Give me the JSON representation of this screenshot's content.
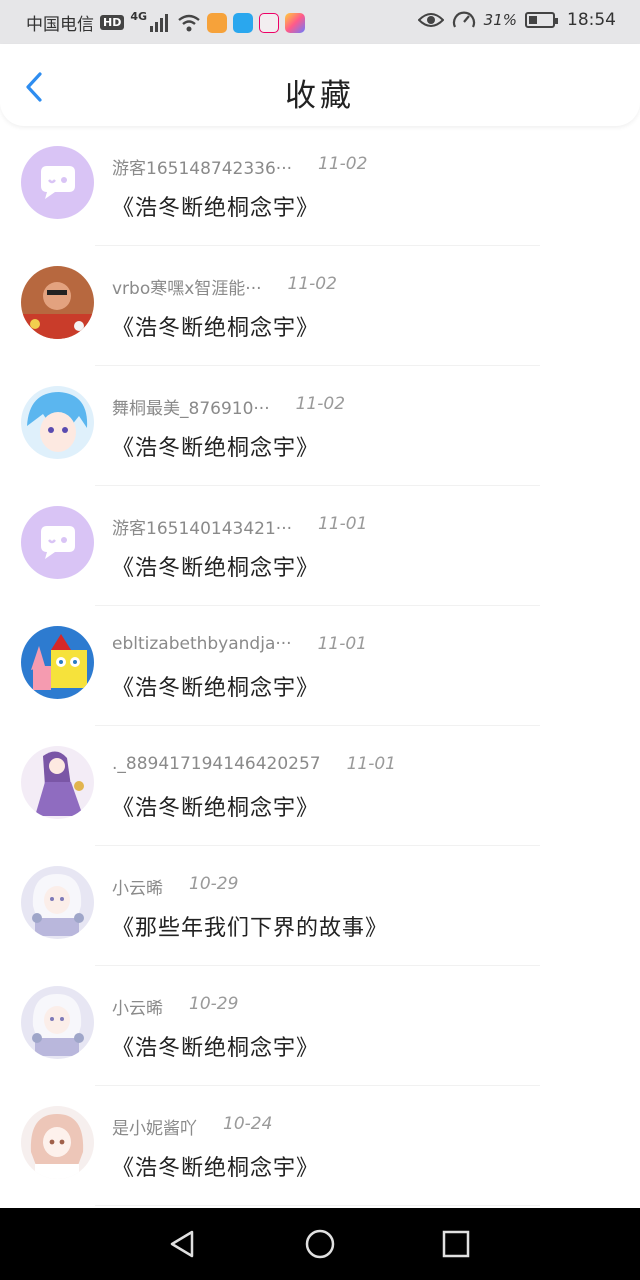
{
  "status_bar": {
    "carrier": "中国电信",
    "hd": "HD",
    "network": "4G",
    "battery_percent": "31%",
    "battery_level": 0.31,
    "time": "18:54"
  },
  "header": {
    "title": "收藏",
    "back_icon": "chevron-left-icon"
  },
  "colors": {
    "accent": "#2e8df0",
    "guest_avatar": "#d9c4f5"
  },
  "favorites": [
    {
      "user": "游客165148742336···",
      "time": "11-02",
      "content": "《浩冬断绝桐念宇》",
      "avatar": "guest-chat-bubble"
    },
    {
      "user": "vrbo寒嘿x智涯能···",
      "time": "11-02",
      "content": "《浩冬断绝桐念宇》",
      "avatar": "user-photo"
    },
    {
      "user": "舞桐最美_876910···",
      "time": "11-02",
      "content": "《浩冬断绝桐念宇》",
      "avatar": "anime-blue-hair"
    },
    {
      "user": "游客165140143421···",
      "time": "11-01",
      "content": "《浩冬断绝桐念宇》",
      "avatar": "guest-chat-bubble"
    },
    {
      "user": "ebltizabethbyandja···",
      "time": "11-01",
      "content": "《浩冬断绝桐念宇》",
      "avatar": "spongebob-patrick"
    },
    {
      "user": "._889417194146420257",
      "time": "11-01",
      "content": "《浩冬断绝桐念宇》",
      "avatar": "anime-purple-dress"
    },
    {
      "user": "小云晞",
      "time": "10-29",
      "content": "《那些年我们下界的故事》",
      "avatar": "anime-white-hair"
    },
    {
      "user": "小云晞",
      "time": "10-29",
      "content": "《浩冬断绝桐念宇》",
      "avatar": "anime-white-hair"
    },
    {
      "user": "是小妮酱吖",
      "time": "10-24",
      "content": "《浩冬断绝桐念宇》",
      "avatar": "anime-pink-hair"
    }
  ],
  "nav": {
    "back": "back-triangle-icon",
    "home": "home-circle-icon",
    "recents": "recents-square-icon"
  }
}
